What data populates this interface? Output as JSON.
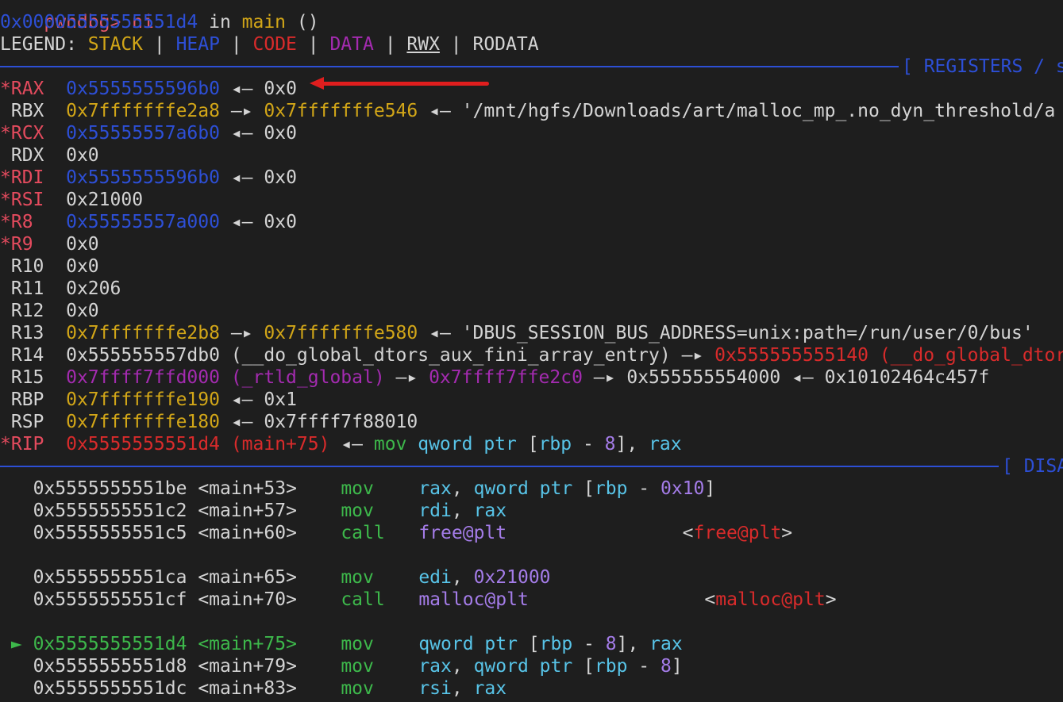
{
  "prompt": {
    "text": "pwndbg> ni"
  },
  "location": {
    "addr": "0x00005555555551d4",
    "in": " in ",
    "func": "main",
    "parens": " ()"
  },
  "legend": {
    "label": "LEGEND: ",
    "stack": "STACK",
    "heap": "HEAP",
    "code": "CODE",
    "data": "DATA",
    "rwx": "RWX",
    "rodata": "RODATA",
    "pipe": " | "
  },
  "sections": {
    "registers": "[ REGISTERS / s",
    "disasm": "[ DISA"
  },
  "registers": [
    {
      "star": "*",
      "name": "RAX",
      "parts": [
        {
          "t": "0x5555555596b0",
          "c": "blue"
        },
        {
          "t": " ◂— ",
          "c": "white"
        },
        {
          "t": "0x0",
          "c": "white"
        }
      ]
    },
    {
      "star": " ",
      "name": "RBX",
      "parts": [
        {
          "t": "0x7fffffffe2a8",
          "c": "yellow"
        },
        {
          "t": " —▸ ",
          "c": "white"
        },
        {
          "t": "0x7fffffffe546",
          "c": "yellow"
        },
        {
          "t": " ◂— '/mnt/hgfs/Downloads/art/malloc_mp_.no_dyn_threshold/a",
          "c": "white"
        }
      ]
    },
    {
      "star": "*",
      "name": "RCX",
      "parts": [
        {
          "t": "0x55555557a6b0",
          "c": "blue"
        },
        {
          "t": " ◂— ",
          "c": "white"
        },
        {
          "t": "0x0",
          "c": "white"
        }
      ]
    },
    {
      "star": " ",
      "name": "RDX",
      "parts": [
        {
          "t": "0x0",
          "c": "white"
        }
      ]
    },
    {
      "star": "*",
      "name": "RDI",
      "parts": [
        {
          "t": "0x5555555596b0",
          "c": "blue"
        },
        {
          "t": " ◂— ",
          "c": "white"
        },
        {
          "t": "0x0",
          "c": "white"
        }
      ]
    },
    {
      "star": "*",
      "name": "RSI",
      "parts": [
        {
          "t": "0x21000",
          "c": "white"
        }
      ]
    },
    {
      "star": "*",
      "name": "R8 ",
      "parts": [
        {
          "t": "0x55555557a000",
          "c": "blue"
        },
        {
          "t": " ◂— ",
          "c": "white"
        },
        {
          "t": "0x0",
          "c": "white"
        }
      ]
    },
    {
      "star": "*",
      "name": "R9 ",
      "parts": [
        {
          "t": "0x0",
          "c": "white"
        }
      ]
    },
    {
      "star": " ",
      "name": "R10",
      "parts": [
        {
          "t": "0x0",
          "c": "white"
        }
      ]
    },
    {
      "star": " ",
      "name": "R11",
      "parts": [
        {
          "t": "0x206",
          "c": "white"
        }
      ]
    },
    {
      "star": " ",
      "name": "R12",
      "parts": [
        {
          "t": "0x0",
          "c": "white"
        }
      ]
    },
    {
      "star": " ",
      "name": "R13",
      "parts": [
        {
          "t": "0x7fffffffe2b8",
          "c": "yellow"
        },
        {
          "t": " —▸ ",
          "c": "white"
        },
        {
          "t": "0x7fffffffe580",
          "c": "yellow"
        },
        {
          "t": " ◂— 'DBUS_SESSION_BUS_ADDRESS=unix:path=/run/user/0/bus'",
          "c": "white"
        }
      ]
    },
    {
      "star": " ",
      "name": "R14",
      "parts": [
        {
          "t": "0x555555557db0 (__do_global_dtors_aux_fini_array_entry)",
          "c": "white"
        },
        {
          "t": " —▸ ",
          "c": "white"
        },
        {
          "t": "0x555555555140 (__do_global_dtor",
          "c": "red"
        }
      ]
    },
    {
      "star": " ",
      "name": "R15",
      "parts": [
        {
          "t": "0x7ffff7ffd000 (_rtld_global)",
          "c": "purple"
        },
        {
          "t": " —▸ ",
          "c": "white"
        },
        {
          "t": "0x7ffff7ffe2c0",
          "c": "purple"
        },
        {
          "t": " —▸ 0x555555554000 ◂— 0x10102464c457f",
          "c": "white"
        }
      ]
    },
    {
      "star": " ",
      "name": "RBP",
      "parts": [
        {
          "t": "0x7fffffffe190",
          "c": "yellow"
        },
        {
          "t": " ◂— ",
          "c": "white"
        },
        {
          "t": "0x1",
          "c": "white"
        }
      ]
    },
    {
      "star": " ",
      "name": "RSP",
      "parts": [
        {
          "t": "0x7fffffffe180",
          "c": "yellow"
        },
        {
          "t": " ◂— ",
          "c": "white"
        },
        {
          "t": "0x7ffff7f88010",
          "c": "white"
        }
      ]
    },
    {
      "star": "*",
      "name": "RIP",
      "parts": [
        {
          "t": "0x5555555551d4 (main+75)",
          "c": "red"
        },
        {
          "t": " ◂— ",
          "c": "white"
        },
        {
          "t": "mov",
          "c": "green"
        },
        {
          "t": " qword ptr ",
          "c": "cyan"
        },
        {
          "t": "[",
          "c": "white"
        },
        {
          "t": "rbp",
          "c": "cyan"
        },
        {
          "t": " - ",
          "c": "white"
        },
        {
          "t": "8",
          "c": "lpurple"
        },
        {
          "t": "], ",
          "c": "white"
        },
        {
          "t": "rax",
          "c": "cyan"
        }
      ]
    }
  ],
  "disasm": [
    {
      "mark": " ",
      "addr": "0x5555555551be",
      "sym": "<main+53>",
      "mn": "mov",
      "ops": [
        {
          "t": "rax",
          "c": "cyan"
        },
        {
          "t": ", ",
          "c": "white"
        },
        {
          "t": "qword ptr",
          "c": "cyan"
        },
        {
          "t": " [",
          "c": "white"
        },
        {
          "t": "rbp",
          "c": "cyan"
        },
        {
          "t": " - ",
          "c": "white"
        },
        {
          "t": "0x10",
          "c": "lpurple"
        },
        {
          "t": "]",
          "c": "white"
        }
      ]
    },
    {
      "mark": " ",
      "addr": "0x5555555551c2",
      "sym": "<main+57>",
      "mn": "mov",
      "ops": [
        {
          "t": "rdi",
          "c": "cyan"
        },
        {
          "t": ", ",
          "c": "white"
        },
        {
          "t": "rax",
          "c": "cyan"
        }
      ]
    },
    {
      "mark": " ",
      "addr": "0x5555555551c5",
      "sym": "<main+60>",
      "mn": "call",
      "ops": [
        {
          "t": "free@plt",
          "c": "lpurple"
        },
        {
          "t": "                <",
          "c": "white"
        },
        {
          "t": "free@plt",
          "c": "red"
        },
        {
          "t": ">",
          "c": "white"
        }
      ]
    },
    {
      "blank": true
    },
    {
      "mark": " ",
      "addr": "0x5555555551ca",
      "sym": "<main+65>",
      "mn": "mov",
      "ops": [
        {
          "t": "edi",
          "c": "cyan"
        },
        {
          "t": ", ",
          "c": "white"
        },
        {
          "t": "0x21000",
          "c": "lpurple"
        }
      ]
    },
    {
      "mark": " ",
      "addr": "0x5555555551cf",
      "sym": "<main+70>",
      "mn": "call",
      "ops": [
        {
          "t": "malloc@plt",
          "c": "lpurple"
        },
        {
          "t": "                <",
          "c": "white"
        },
        {
          "t": "malloc@plt",
          "c": "red"
        },
        {
          "t": ">",
          "c": "white"
        }
      ]
    },
    {
      "blank": true
    },
    {
      "mark": "►",
      "addr": "0x5555555551d4",
      "sym": "<main+75>",
      "mn": "mov",
      "current": true,
      "ops": [
        {
          "t": "qword ptr",
          "c": "cyan"
        },
        {
          "t": " [",
          "c": "white"
        },
        {
          "t": "rbp",
          "c": "cyan"
        },
        {
          "t": " - ",
          "c": "white"
        },
        {
          "t": "8",
          "c": "lpurple"
        },
        {
          "t": "], ",
          "c": "white"
        },
        {
          "t": "rax",
          "c": "cyan"
        }
      ]
    },
    {
      "mark": " ",
      "addr": "0x5555555551d8",
      "sym": "<main+79>",
      "mn": "mov",
      "ops": [
        {
          "t": "rax",
          "c": "cyan"
        },
        {
          "t": ", ",
          "c": "white"
        },
        {
          "t": "qword ptr",
          "c": "cyan"
        },
        {
          "t": " [",
          "c": "white"
        },
        {
          "t": "rbp",
          "c": "cyan"
        },
        {
          "t": " - ",
          "c": "white"
        },
        {
          "t": "8",
          "c": "lpurple"
        },
        {
          "t": "]",
          "c": "white"
        }
      ]
    },
    {
      "mark": " ",
      "addr": "0x5555555551dc",
      "sym": "<main+83>",
      "mn": "mov",
      "ops": [
        {
          "t": "rsi",
          "c": "cyan"
        },
        {
          "t": ", ",
          "c": "white"
        },
        {
          "t": "rax",
          "c": "cyan"
        }
      ]
    }
  ],
  "colors": {
    "background": "#1e1e1e",
    "blue": "#2d4fd6",
    "yellow": "#d2a618",
    "red": "#d92b2b",
    "purple": "#a42bb0",
    "green": "#3db84b",
    "cyan": "#58c4e8",
    "annotation_arrow": "#e01e1e"
  },
  "icons": {
    "annotation": "red-arrow-icon",
    "current_instruction": "triangle-right-icon"
  }
}
